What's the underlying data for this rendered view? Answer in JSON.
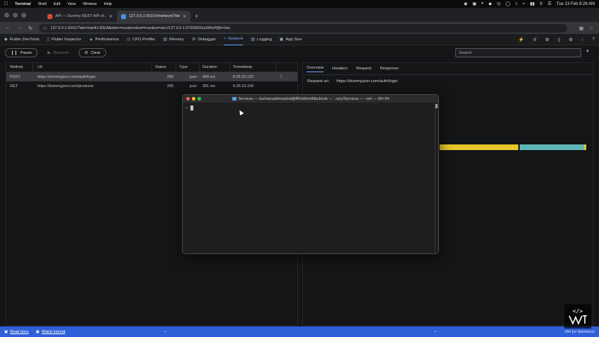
{
  "menubar": {
    "app": "Terminal",
    "items": [
      "Shell",
      "Edit",
      "View",
      "Window",
      "Help"
    ],
    "clock": "Tue 13 Feb  8:26 AM"
  },
  "browser": {
    "tabs": [
      {
        "label": "API — Dummy REST API of JSO",
        "active": false
      },
      {
        "label": "127.0.0.1:9101/#/network?ide=Intell",
        "active": true
      }
    ],
    "url": "127.0.0.1:9101/?ide=IntelliJ-IDEA&dark=true&embed=true&uri=ws://127.0.0.1:57936/DGa546xPj8k=/ws"
  },
  "devtools": {
    "tabs": [
      {
        "label": "Flutter DevTools",
        "icon": "devtools-icon"
      },
      {
        "label": "Flutter Inspector",
        "icon": "phone-icon"
      },
      {
        "label": "Performance",
        "icon": "performance-icon"
      },
      {
        "label": "CPU Profiler",
        "icon": "timer-icon"
      },
      {
        "label": "Memory",
        "icon": "memory-icon"
      },
      {
        "label": "Debugger",
        "icon": "bug-icon"
      },
      {
        "label": "Network",
        "icon": "wifi-icon",
        "active": true
      },
      {
        "label": "Logging",
        "icon": "logging-icon"
      },
      {
        "label": "App Size",
        "icon": "app-size-icon"
      }
    ]
  },
  "network": {
    "pause_label": "Pause",
    "resume_label": "Resume",
    "clear_label": "Clear",
    "search_placeholder": "Search",
    "columns": {
      "method": "Method",
      "uri": "Uri",
      "status": "Status",
      "type": "Type",
      "duration": "Duration",
      "timestamp": "Timestamp"
    },
    "rows": [
      {
        "method": "POST",
        "uri": "https://dummyjson.com/auth/login",
        "status": "200",
        "type": "json",
        "duration": "499 ms",
        "timestamp": "6:26:22.133",
        "selected": true
      },
      {
        "method": "GET",
        "uri": "https://dummyjson.com/products",
        "status": "200",
        "type": "json",
        "duration": "381 ms",
        "timestamp": "6:26:23.158",
        "selected": false
      }
    ]
  },
  "detail": {
    "tabs": [
      "Overview",
      "Headers",
      "Request",
      "Response"
    ],
    "request_uri_label": "Request uri:",
    "request_uri_value": "https://dummyjson.com/auth/login",
    "timing_fraction_waiting": 0.53,
    "timing_fraction_receiving": 0.47
  },
  "terminal": {
    "title": "Services — burhanuddinrashid@BRsWorkMacbook — ..rary/Services — -zsh — 80×24",
    "prompt": "~"
  },
  "statusbar": {
    "left1": "Read docs",
    "left2": "Watch tutorial",
    "right": "v64 (or dummies)"
  },
  "colors": {
    "accent": "#6fa8ff",
    "statusbar": "#2f5fd6",
    "timing_waiting": "#e6c62a",
    "timing_receiving": "#5fb6b6"
  }
}
